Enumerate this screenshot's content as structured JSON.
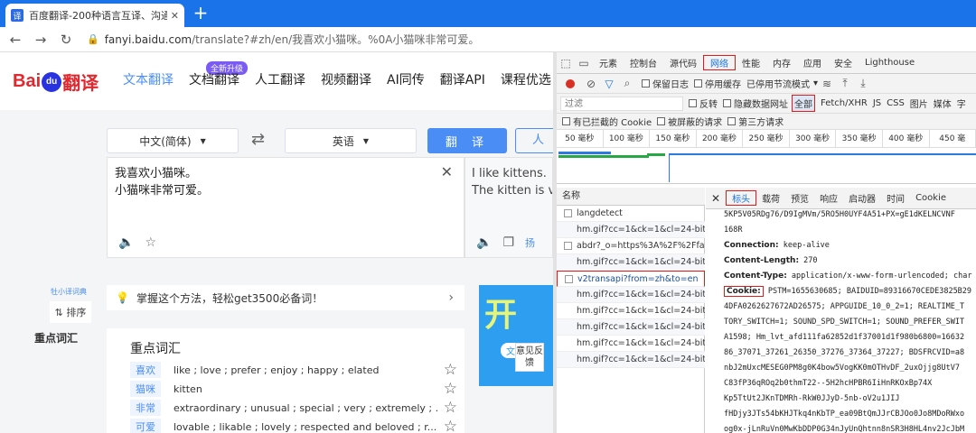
{
  "browser": {
    "tab_title": "百度翻译-200种语言互译、沟通",
    "tab_favicon": "译",
    "tab_close": "✕",
    "new_tab": "+",
    "url_host": "fanyi.baidu.com",
    "url_path": "/translate?#zh/en/我喜欢小猫咪。%0A小猫咪非常可爱。"
  },
  "site": {
    "logo_left": "Bai",
    "logo_paw": "du",
    "logo_right": "翻译",
    "new_badge": "全新升级",
    "nav": [
      "文本翻译",
      "文档翻译",
      "人工翻译",
      "视频翻译",
      "AI同传",
      "翻译API",
      "课程优选"
    ],
    "source_lang": "中文(简体)",
    "target_lang": "英语",
    "translate_button": "翻 译",
    "human_button": "人",
    "source_text": "我喜欢小猫咪。\n小猫咪非常可爱。",
    "result_text": "I like kittens.\nThe kitten is v",
    "result_extra": "扬",
    "dict_label": "牡小译词典",
    "sort_button": "⇅ 排序",
    "sidebar_keywords": "重点词汇",
    "tip_text": "掌握这个方法，轻松get3500必备词！",
    "ad_text": "开",
    "ad_button": "文档",
    "feedback": "意见反馈",
    "vocab_title": "重点词汇",
    "vocab": [
      {
        "word": "喜欢",
        "def": "like ; love ; prefer ; enjoy ; happy ; elated"
      },
      {
        "word": "猫咪",
        "def": "kitten"
      },
      {
        "word": "非常",
        "def": "extraordinary ; unusual ; special ; very ; extremely ; ..."
      },
      {
        "word": "可爱",
        "def": "lovable ; likable ; lovely ; respected and beloved ; r..."
      }
    ]
  },
  "devtools": {
    "tabs": [
      "元素",
      "控制台",
      "源代码",
      "网络",
      "性能",
      "内存",
      "应用",
      "安全",
      "Lighthouse"
    ],
    "active_tab": "网络",
    "preserve_log": "保留日志",
    "disable_cache": "停用缓存",
    "throttling": "已停用节流模式",
    "filter_placeholder": "过滤",
    "invert": "反转",
    "hide_data_urls": "隐藏数据网址",
    "filter_types": [
      "全部",
      "Fetch/XHR",
      "JS",
      "CSS",
      "图片",
      "媒体",
      "字"
    ],
    "blocked_cookies": "有已拦截的 Cookie",
    "blocked_requests": "被屏蔽的请求",
    "third_party": "第三方请求",
    "timeline": [
      "50 毫秒",
      "100 毫秒",
      "150 毫秒",
      "200 毫秒",
      "250 毫秒",
      "300 毫秒",
      "350 毫秒",
      "400 毫秒",
      "450 毫"
    ],
    "name_header": "名称",
    "requests": [
      "langdetect",
      "hm.gif?cc=1&ck=1&cl=24-bit...",
      "abdr?_o=https%3A%2F%2Ffa...",
      "hm.gif?cc=1&ck=1&cl=24-bit...",
      "v2transapi?from=zh&to=en",
      "hm.gif?cc=1&ck=1&cl=24-bit...",
      "hm.gif?cc=1&ck=1&cl=24-bit...",
      "hm.gif?cc=1&ck=1&cl=24-bit...",
      "hm.gif?cc=1&ck=1&cl=24-bit...",
      "hm.gif?cc=1&ck=1&cl=24-bit..."
    ],
    "header_tabs": [
      "标头",
      "载荷",
      "预览",
      "响应",
      "启动器",
      "时间",
      "Cookie"
    ],
    "header_lines": [
      {
        "key": "",
        "value": "5KP5V05RDg76/D9IgMVm/5RO5H0UYF4A51+PX=gE1dKELNCVNF"
      },
      {
        "key": "",
        "value": "168R"
      },
      {
        "key": "Connection:",
        "value": " keep-alive"
      },
      {
        "key": "Content-Length:",
        "value": " 270"
      },
      {
        "key": "Content-Type:",
        "value": " application/x-www-form-urlencoded; char"
      },
      {
        "key": "Cookie:",
        "value": " PSTM=1655630685; BAIDUID=89316670CEDE3825B29"
      },
      {
        "key": "",
        "value": "4DFA0262627672AD26575; APPGUIDE_10_0_2=1; REALTIME_T"
      },
      {
        "key": "",
        "value": "TORY_SWITCH=1; SOUND_SPD_SWITCH=1; SOUND_PREFER_SWIT"
      },
      {
        "key": "",
        "value": "A1598; Hm_lvt_afd111fa62852d1f37001d1f980b6800=16632"
      },
      {
        "key": "",
        "value": "86_37071_37261_26350_37276_37364_37227; BDSFRCVID=a8"
      },
      {
        "key": "",
        "value": "nbJ2mUxcMESEG0PM8g0K4bow5VogKK0mOTHvDF_2uxOjjg8UtV7"
      },
      {
        "key": "",
        "value": "C83fP36qROq2b0thmT22--5H2hcHPBR6IiHnRKOxBp74X"
      },
      {
        "key": "",
        "value": "Kp5TtUt2JKnTDMRh-RkW0JJyD-5nb-oV2u1JIJ"
      },
      {
        "key": "",
        "value": "fHDjy3JTs54bKHJTkq4nKbTP_ea09BtQmJJrCBJOo0Jo8MDoRWxo"
      },
      {
        "key": "",
        "value": "og0x-jLnRuVn0MwKbDDP0G34nJyUnQhtnn8nSR3H8HL4nv2JcJbM"
      }
    ]
  },
  "colors": {
    "chrome_blue": "#1a73e8",
    "baidu_blue": "#4a8ef5",
    "highlight_red": "#e01b1b"
  }
}
